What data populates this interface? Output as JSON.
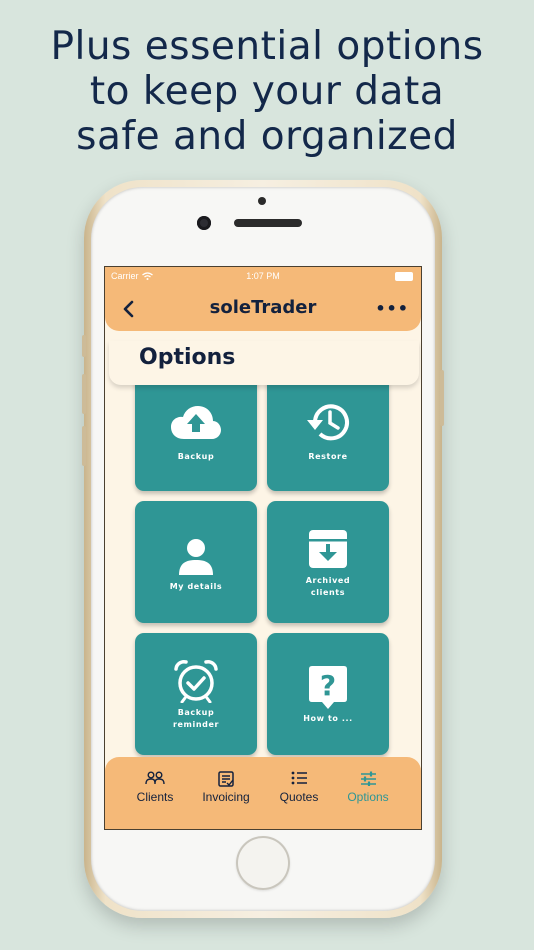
{
  "headline": {
    "line1": "Plus essential options",
    "line2": "to keep your data",
    "line3": "safe and organized"
  },
  "status_bar": {
    "carrier": "Carrier",
    "time": "1:07 PM"
  },
  "nav": {
    "title": "soleTrader",
    "back_icon": "chevron-left-icon",
    "more_icon": "ellipsis-icon"
  },
  "page": {
    "title": "Options"
  },
  "tiles": [
    {
      "label": "Backup",
      "icon": "cloud-upload-icon"
    },
    {
      "label": "Restore",
      "icon": "history-icon"
    },
    {
      "label": "My details",
      "icon": "person-icon"
    },
    {
      "label": "Archived",
      "label2": "clients",
      "icon": "archive-box-icon"
    },
    {
      "label": "Backup",
      "label2": "reminder",
      "icon": "alarm-clock-icon"
    },
    {
      "label": "How to ...",
      "icon": "help-icon"
    }
  ],
  "tabs": [
    {
      "label": "Clients",
      "icon": "people-icon",
      "active": false
    },
    {
      "label": "Invoicing",
      "icon": "invoice-icon",
      "active": false
    },
    {
      "label": "Quotes",
      "icon": "list-icon",
      "active": false
    },
    {
      "label": "Options",
      "icon": "sliders-icon",
      "active": true
    }
  ],
  "colors": {
    "background": "#d8e5dd",
    "headline": "#13284a",
    "nav_bar": "#f5b978",
    "tile": "#2f9695",
    "screen_bg": "#fdf5e6",
    "active_tab": "#2f9695"
  }
}
